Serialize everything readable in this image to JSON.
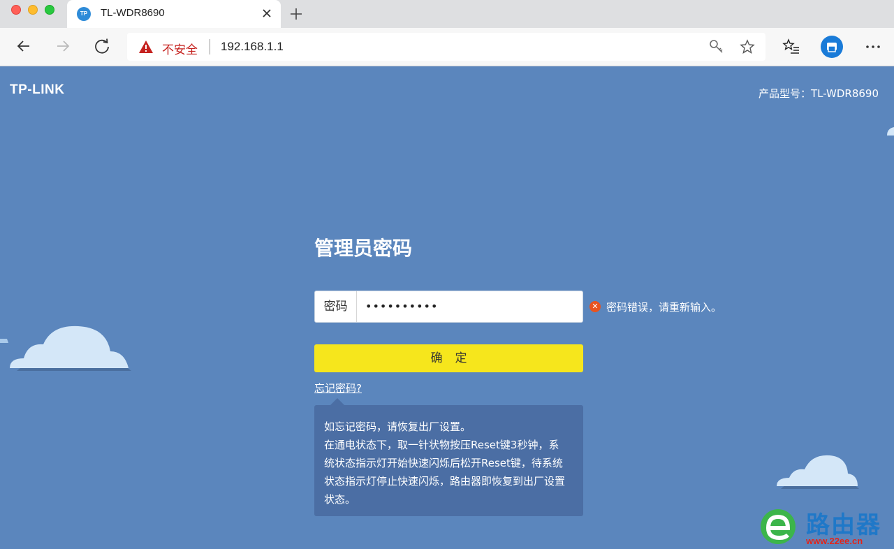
{
  "browser": {
    "tab": {
      "favicon_text": "TP",
      "title": "TL-WDR8690"
    },
    "address_bar": {
      "security_label": "不安全",
      "url": "192.168.1.1"
    }
  },
  "header": {
    "logo": "TP-LINK",
    "model_label": "产品型号：TL-WDR8690"
  },
  "login": {
    "title": "管理员密码",
    "password_label": "密码",
    "password_value": "••••••••••",
    "error_message": "密码错误，请重新输入。",
    "confirm_label": "确定",
    "forgot_link": "忘记密码?",
    "help_lines": [
      "如忘记密码，请恢复出厂设置。",
      "在通电状态下，取一针状物按压Reset键3秒钟，系",
      "统状态指示灯开始快速闪烁后松开Reset键，待系统",
      "状态指示灯停止快速闪烁，路由器即恢复到出厂设置",
      "状态。"
    ]
  },
  "watermark": {
    "text": "路由器",
    "url": "www.22ee.cn"
  },
  "colors": {
    "page_bg": "#5b86bd",
    "button_yellow": "#f6e61c",
    "help_bg": "#4b6ea4",
    "error_red": "#e8531f",
    "insecure_red": "#c5221f"
  }
}
